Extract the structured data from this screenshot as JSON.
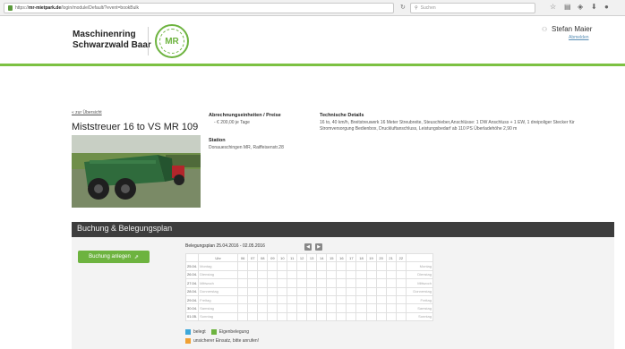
{
  "browser": {
    "url_prefix": "https://",
    "url_domain": "mr-mietpark.de",
    "url_path": "/login/module/Default/?event=bookBulk",
    "search_placeholder": "Suchen"
  },
  "header": {
    "brand_line1": "Maschinenring",
    "brand_line2": "Schwarzwald Baar",
    "logo_text": "MR",
    "user_name": "Stefan Maier",
    "logout_label": "Abmelden"
  },
  "machine": {
    "back_link": "« zur Übersicht",
    "title": "Miststreuer 16 to VS MR 109",
    "billing_label": "Abrechnungseinheiten / Preise",
    "billing_value": "- € 200,00 je Tage",
    "station_label": "Station",
    "station_value": "Donaueschingen MR, Raiffeisenstr.28",
    "tech_label": "Technische Details",
    "tech_value": "16 to, 40 km/h, Breitstreuwerk 16 Meter Streubreite, Steuschieber,Anschlüsse: 1 DW Anschluss + 1 EW, 1 dreipoliger Stecker für Stromversorgung Bedienbox, Druckluftanschluss, Leistungsbedarf ab 110 PS Überladehöhe 2,90 m"
  },
  "booking": {
    "section_title": "Buchung & Belegungsplan",
    "button_label": "Buchung anlegen",
    "plan_label": "Belegungsplan 25.04.2016 - 02.05.2016",
    "hour_label": "Uhr",
    "hours": [
      "06",
      "07",
      "08",
      "09",
      "10",
      "11",
      "12",
      "13",
      "14",
      "15",
      "16",
      "17",
      "18",
      "19",
      "20",
      "21",
      "22"
    ],
    "rows": [
      {
        "date": "25.04.",
        "day": "Montag"
      },
      {
        "date": "26.04.",
        "day": "Dienstag"
      },
      {
        "date": "27.04.",
        "day": "Mittwoch"
      },
      {
        "date": "28.04.",
        "day": "Donnerstag"
      },
      {
        "date": "29.04.",
        "day": "Freitag"
      },
      {
        "date": "30.04.",
        "day": "Samstag"
      },
      {
        "date": "01.05.",
        "day": "Sonntag"
      }
    ],
    "legend": {
      "booked": "belegt",
      "own": "Eigenbelegung",
      "uncertain": "unsicherer Einsatz, bitte anrufen!"
    },
    "colors": {
      "booked": "#3da7d9",
      "own": "#6db33f",
      "uncertain": "#f0a032"
    }
  }
}
